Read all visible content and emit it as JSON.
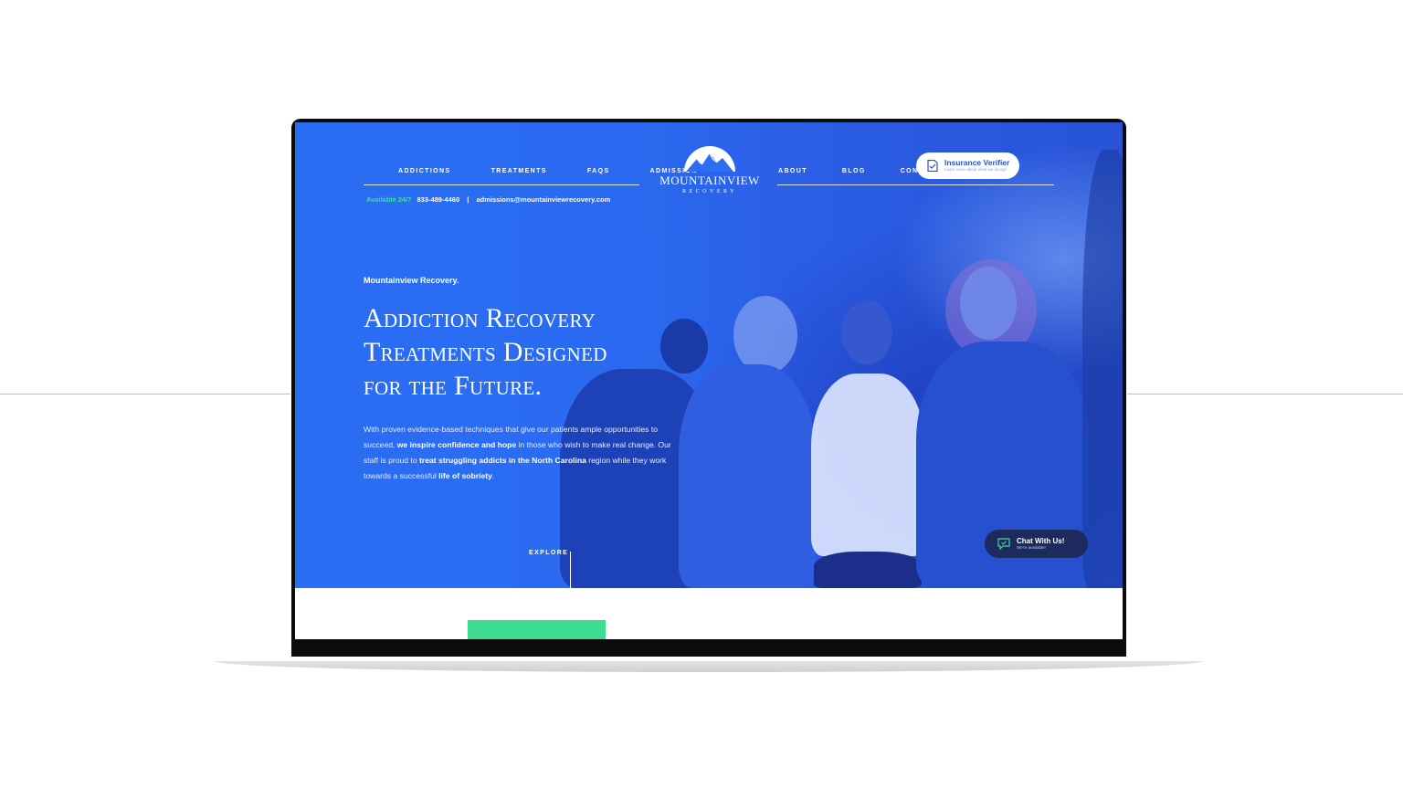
{
  "brand": {
    "name": "MOUNTAINVIEW",
    "tagline": "RECOVERY"
  },
  "nav": {
    "left_items": [
      "ADDICTIONS",
      "TREATMENTS",
      "FAQS",
      "ADMISSION"
    ],
    "right_items": [
      "ABOUT",
      "BLOG",
      "CONTACT"
    ]
  },
  "contact": {
    "availability": "Available 24/7",
    "phone": "833-489-4460",
    "separator": "|",
    "email": "admissions@mountainviewrecovery.com"
  },
  "insurance": {
    "title": "Insurance Verifier",
    "subtitle": "Learn more about what we accept"
  },
  "hero": {
    "eyebrow": "Mountainview Recovery.",
    "headline_lines": [
      "Addiction Recovery",
      "Treatments Designed",
      "for the Future."
    ],
    "body": {
      "p1": "With proven evidence-based techniques that give our patients ample opportunities to succeed, ",
      "b1": "we inspire confidence and hope",
      "p2": " in those who wish to make real change. Our staff is proud to ",
      "b2": "treat struggling addicts in the North Carolina",
      "p3": " region while they work towards a successful ",
      "b3": "life of sobriety",
      "p4": "."
    },
    "explore": "EXPLORE"
  },
  "chat": {
    "title": "Chat With Us!",
    "subtitle": "We're available!"
  },
  "colors": {
    "hero_blue": "#2a6ef4",
    "accent_green": "#3ddc8f",
    "chat_navy": "#1c2a5e",
    "button_blue": "#1f53d8"
  },
  "icons": {
    "insurance": "document-icon",
    "chat": "chat-bubble-icon",
    "logo": "mountain-icon"
  }
}
